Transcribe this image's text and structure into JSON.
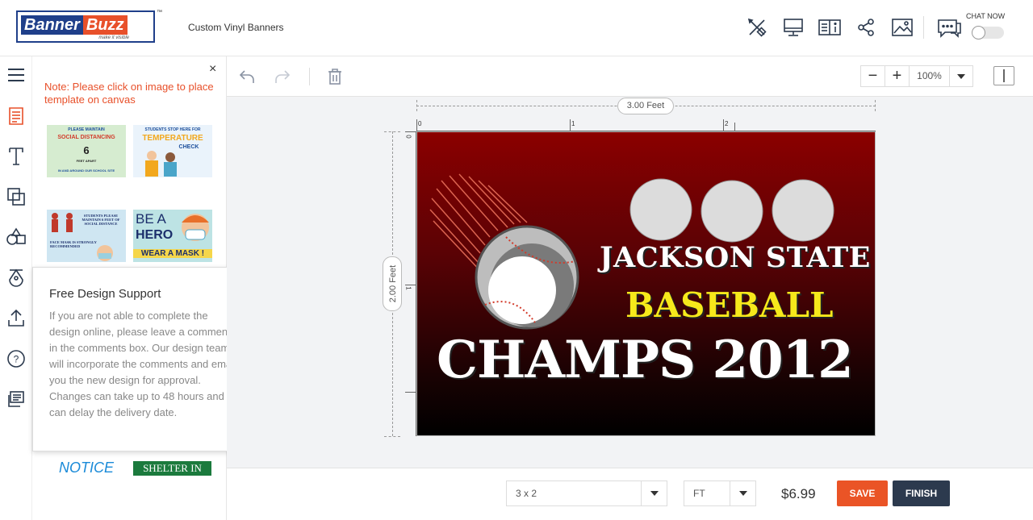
{
  "header": {
    "logo_left": "Banner",
    "logo_right": "Buzz",
    "logo_tagline": "make it visible",
    "trademark": "™",
    "product_name": "Custom Vinyl Banners",
    "icons": [
      "tools-icon",
      "desktop-preview-icon",
      "book-info-icon",
      "share-icon",
      "image-icon"
    ],
    "chat_label": "CHAT NOW"
  },
  "sidebar": {
    "items": [
      "menu-icon",
      "templates-icon",
      "text-icon",
      "layers-icon",
      "shapes-icon",
      "clipart-icon",
      "upload-icon",
      "help-icon",
      "comments-icon"
    ]
  },
  "template_panel": {
    "close": "×",
    "note": "Note: Please click on image to place template on canvas",
    "thumbs": [
      {
        "line1": "PLEASE MAINTAIN",
        "line2": "SOCIAL DISTANCING",
        "line3": "6",
        "line4": "FEET APART",
        "line5": "IN AND AROUND OUR SCHOOL SITE"
      },
      {
        "line1": "STUDENTS STOP HERE FOR",
        "line2": "TEMPERATURE",
        "line3": "CHECK"
      },
      {
        "line1": "STUDENTS PLEASE MAINTAIN 6 FEET OF SOCIAL DISTANCE",
        "line2": "FACE MASK IS STRONGLY RECOMMENDED"
      },
      {
        "line1": "BE A",
        "line2": "HERO",
        "line3": "WEAR A MASK !"
      },
      {
        "line1": "NOTICE"
      },
      {
        "line1": "SHELTER IN"
      }
    ]
  },
  "popup": {
    "title": "Free Design Support",
    "close": "×",
    "body": "If you are not able to complete the design online, please leave a comments in the comments box. Our design team will incorporate the comments and email you the new design for approval. Changes can take up to 48 hours and can delay the delivery date."
  },
  "toolbar": {
    "undo": "undo-icon",
    "redo": "redo-icon",
    "delete": "trash-icon",
    "zoom_minus": "−",
    "zoom_plus": "+",
    "zoom_value": "100%"
  },
  "canvas": {
    "width_label": "3.00 Feet",
    "height_label": "2.00 Feet",
    "ruler_top": [
      "0",
      "1",
      "2"
    ],
    "ruler_left": [
      "0",
      "1"
    ],
    "line1": "JACKSON STATE",
    "line2": "BASEBALL",
    "line3": "CHAMPS 2012",
    "colors": {
      "bg_top": "#8b0000",
      "bg_bottom": "#000000",
      "text_white": "#ffffff",
      "text_yellow": "#f6e91b"
    }
  },
  "bottom": {
    "size_value": "3 x 2",
    "unit_value": "FT",
    "price": "$6.99",
    "save_label": "SAVE",
    "finish_label": "FINISH",
    "colors": {
      "save": "#ea5426",
      "finish": "#2c3a4e"
    }
  }
}
